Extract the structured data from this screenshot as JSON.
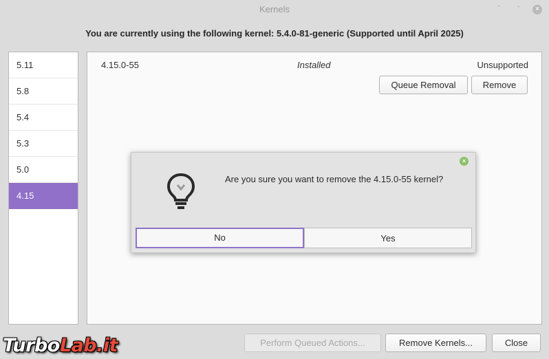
{
  "window": {
    "title": "Kernels",
    "controls": {
      "minimize": "ˇ",
      "maximize": "˚",
      "close": "×"
    }
  },
  "current_kernel_text": "You are currently using the following kernel: 5.4.0-81-generic (Supported until April 2025)",
  "sidebar": {
    "items": [
      {
        "label": "5.11",
        "selected": false
      },
      {
        "label": "5.8",
        "selected": false
      },
      {
        "label": "5.4",
        "selected": false
      },
      {
        "label": "5.3",
        "selected": false
      },
      {
        "label": "5.0",
        "selected": false
      },
      {
        "label": "4.15",
        "selected": true
      }
    ]
  },
  "kernel_row": {
    "version": "4.15.0-55",
    "state": "Installed",
    "support": "Unsupported",
    "queue_removal_label": "Queue Removal",
    "remove_label": "Remove"
  },
  "dialog": {
    "icon": "lightbulb-icon",
    "close_glyph": "×",
    "question": "Are you sure you want to remove the 4.15.0-55 kernel?",
    "no_label": "No",
    "yes_label": "Yes"
  },
  "footer": {
    "perform_label": "Perform Queued Actions...",
    "remove_kernels_label": "Remove Kernels...",
    "close_label": "Close"
  },
  "watermark": {
    "part1": "Turbo",
    "part2": "Lab.it"
  },
  "colors": {
    "accent": "#9070c8",
    "dialog_close": "#8fbf6a",
    "watermark_red": "#e34a3a"
  }
}
